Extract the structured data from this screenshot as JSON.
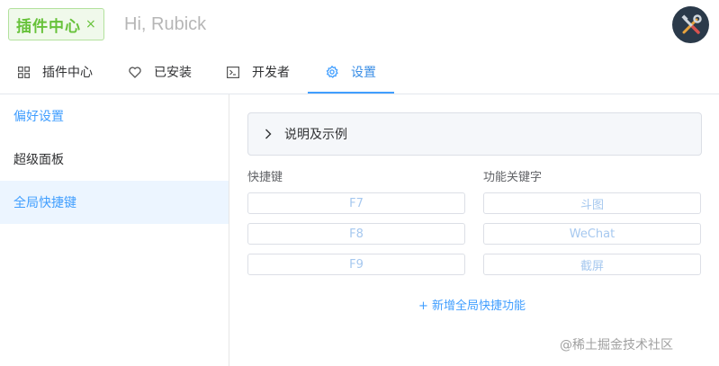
{
  "search": {
    "tag_label": "插件中心",
    "tag_close": "×",
    "placeholder": "Hi, Rubick"
  },
  "tabs": [
    {
      "label": "插件中心",
      "icon": "grid-icon"
    },
    {
      "label": "已安装",
      "icon": "heart-icon"
    },
    {
      "label": "开发者",
      "icon": "terminal-icon"
    },
    {
      "label": "设置",
      "icon": "gear-icon",
      "active": true
    }
  ],
  "sidebar": {
    "items": [
      {
        "label": "偏好设置"
      },
      {
        "label": "超级面板"
      },
      {
        "label": "全局快捷键",
        "active": true
      }
    ]
  },
  "main": {
    "collapse_title": "说明及示例",
    "shortcut_header": "快捷键",
    "keyword_header": "功能关键字",
    "rows": [
      {
        "key": "F7",
        "keyword": "斗图"
      },
      {
        "key": "F8",
        "keyword": "WeChat"
      },
      {
        "key": "F9",
        "keyword": "截屏"
      }
    ],
    "add_label": "+ 新增全局快捷功能"
  },
  "watermark": "@稀土掘金技术社区",
  "colors": {
    "accent": "#409eff",
    "tag_green": "#67c23a",
    "active_bg": "#ecf5ff"
  }
}
